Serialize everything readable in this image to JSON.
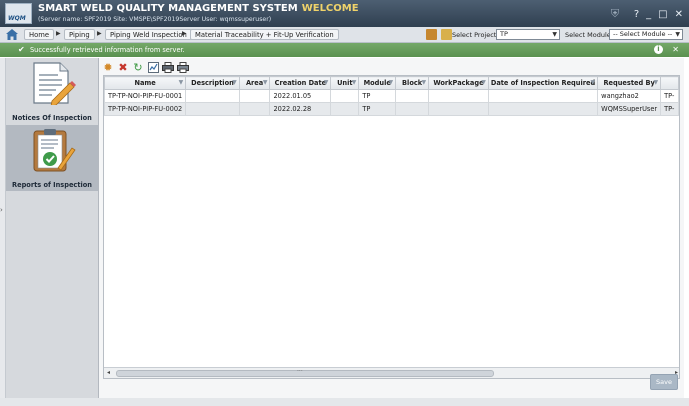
{
  "app": {
    "title": "SMART WELD QUALITY MANAGEMENT SYSTEM",
    "welcome": "WELCOME",
    "server_info": "(Server name: SPF2019 Site: VMSPE\\SPF2019Server User: wqmssuperuser)",
    "logo_text": "WQM",
    "window_controls": {
      "help": "?",
      "minimize": "_",
      "restore": "□",
      "close": "✕"
    }
  },
  "breadcrumb": {
    "items": [
      "Home",
      "Piping",
      "Piping Weld Inspection",
      "Material Traceability + Fit-Up Verification"
    ]
  },
  "project": {
    "label": "Select Project:",
    "value": "TP",
    "module_label": "Select Module:",
    "module_value": "-- Select Module --"
  },
  "status": {
    "message": "Successfully retrieved information from server.",
    "color": "#5a9150"
  },
  "sidebar": {
    "items": [
      {
        "label": "Notices Of Inspection",
        "icon": "notice-document-icon"
      },
      {
        "label": "Reports of Inspection",
        "icon": "report-clipboard-check-icon"
      }
    ]
  },
  "toolbar": {
    "icons": [
      "gear-icon",
      "delete-icon",
      "refresh-icon",
      "chart-icon",
      "print-icon",
      "print-preview-icon"
    ]
  },
  "grid": {
    "columns": [
      "Name",
      "Description",
      "Area",
      "Creation Date",
      "Unit",
      "Module",
      "Block",
      "WorkPackage",
      "Date of Inspection Required",
      "Requested By",
      ""
    ],
    "rows": [
      [
        "TP-TP-NOI-PIP-FU-0001",
        "",
        "",
        "2022.01.05",
        "",
        "TP",
        "",
        "",
        "",
        "wangzhao2",
        "TP-"
      ],
      [
        "TP-TP-NOI-PIP-FU-0002",
        "",
        "",
        "2022.02.28",
        "",
        "TP",
        "",
        "",
        "",
        "WQMSSuperUser",
        "TP-"
      ]
    ]
  },
  "actions": {
    "save_label": "Save"
  }
}
